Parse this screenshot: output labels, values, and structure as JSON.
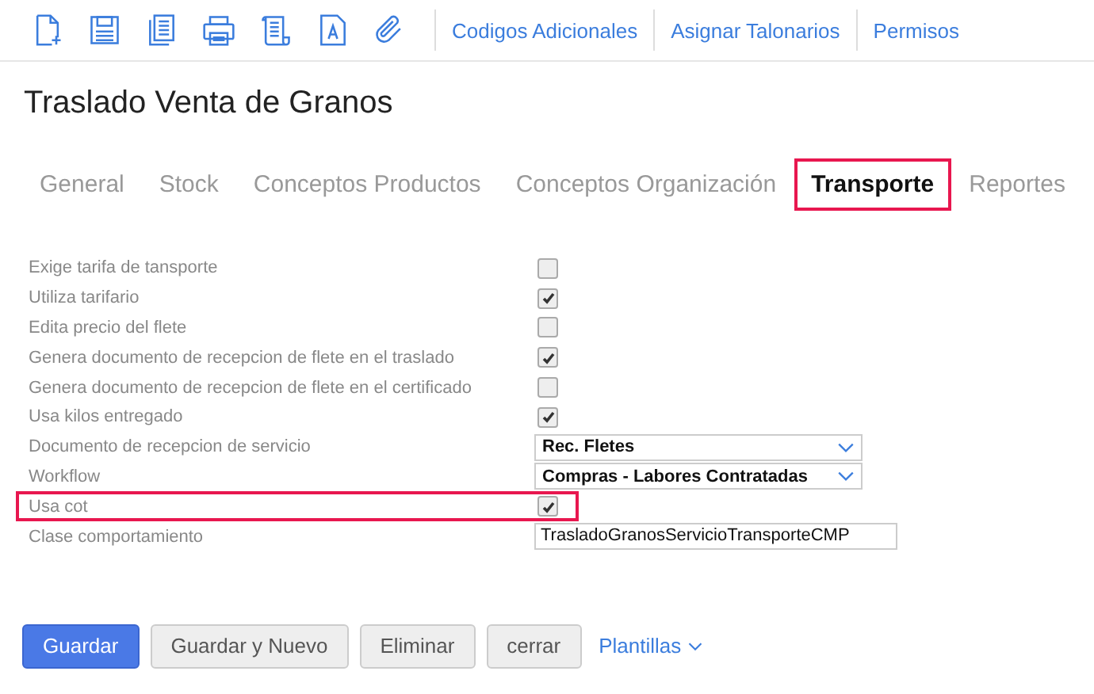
{
  "toolbar": {
    "icons": [
      {
        "kind": "new"
      },
      {
        "kind": "save"
      },
      {
        "kind": "copy"
      },
      {
        "kind": "print"
      },
      {
        "kind": "scroll"
      },
      {
        "kind": "font"
      },
      {
        "kind": "attach"
      }
    ],
    "links": [
      "Codigos Adicionales",
      "Asignar Talonarios",
      "Permisos"
    ]
  },
  "title": "Traslado Venta de Granos",
  "tabs": [
    {
      "label": "General",
      "selected": false,
      "highlighted": false
    },
    {
      "label": "Stock",
      "selected": false,
      "highlighted": false
    },
    {
      "label": "Conceptos Productos",
      "selected": false,
      "highlighted": false
    },
    {
      "label": "Conceptos Organización",
      "selected": false,
      "highlighted": false
    },
    {
      "label": "Transporte",
      "selected": true,
      "highlighted": true
    },
    {
      "label": "Reportes",
      "selected": false,
      "highlighted": false
    }
  ],
  "fields": [
    {
      "label": "Exige tarifa de tansporte",
      "kind": "checkbox",
      "checked": false,
      "highlighted": false
    },
    {
      "label": "Utiliza tarifario",
      "kind": "checkbox",
      "checked": true,
      "highlighted": false
    },
    {
      "label": "Edita precio del flete",
      "kind": "checkbox",
      "checked": false,
      "highlighted": false
    },
    {
      "label": "Genera documento de recepcion de flete en el traslado",
      "kind": "checkbox",
      "checked": true,
      "highlighted": false
    },
    {
      "label": "Genera documento de recepcion de flete en el certificado",
      "kind": "checkbox",
      "checked": false,
      "highlighted": false
    },
    {
      "label": "Usa kilos entregado",
      "kind": "checkbox",
      "checked": true,
      "highlighted": false
    },
    {
      "label": "Documento de recepcion de servicio",
      "kind": "select",
      "value": "Rec. Fletes",
      "highlighted": false
    },
    {
      "label": "Workflow",
      "kind": "select",
      "value": "Compras - Labores Contratadas",
      "highlighted": false
    },
    {
      "label": "Usa cot",
      "kind": "checkbox",
      "checked": true,
      "highlighted": true
    },
    {
      "label": "Clase comportamiento",
      "kind": "text",
      "value": "TrasladoGranosServicioTransporteCMP",
      "highlighted": false
    }
  ],
  "buttons": [
    {
      "label": "Guardar",
      "kind": "primary"
    },
    {
      "label": "Guardar y Nuevo",
      "kind": "default"
    },
    {
      "label": "Eliminar",
      "kind": "default"
    },
    {
      "label": "cerrar",
      "kind": "default"
    }
  ],
  "dropdown": {
    "label": "Plantillas"
  }
}
